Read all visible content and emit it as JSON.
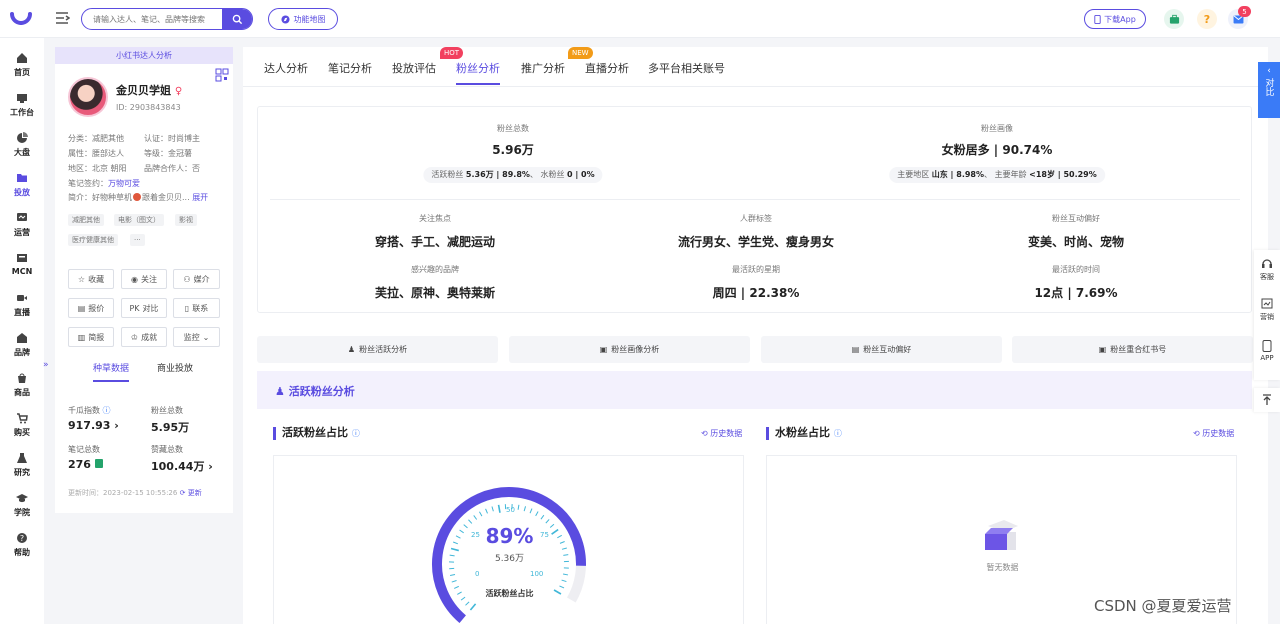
{
  "header": {
    "search_placeholder": "请输入达人、笔记、品牌等搜索",
    "map_label": "功能地图",
    "download_label": "下载App",
    "notification_count": "5",
    "accent": "#5a4ce0"
  },
  "nav": {
    "items": [
      {
        "label": "首页",
        "icon": "home-icon"
      },
      {
        "label": "工作台",
        "icon": "workbench-icon"
      },
      {
        "label": "大盘",
        "icon": "pie-chart-icon"
      },
      {
        "label": "投放",
        "icon": "folder-icon"
      },
      {
        "label": "运营",
        "icon": "operations-icon"
      },
      {
        "label": "MCN",
        "icon": "mcn-icon"
      },
      {
        "label": "直播",
        "icon": "video-icon"
      },
      {
        "label": "品牌",
        "icon": "brand-icon"
      },
      {
        "label": "商品",
        "icon": "goods-icon"
      },
      {
        "label": "购买",
        "icon": "cart-icon"
      },
      {
        "label": "研究",
        "icon": "research-icon"
      },
      {
        "label": "学院",
        "icon": "academy-icon"
      },
      {
        "label": "帮助",
        "icon": "help-icon"
      }
    ],
    "expand_label": "»"
  },
  "profile": {
    "header": "小红书达人分析",
    "name": "金贝贝学姐",
    "gender": "♀",
    "id": "ID: 2903843843",
    "category": "分类：减肥其他",
    "certification": "认证：时尚博主",
    "attribute": "属性：腰部达人",
    "level": "等级：金冠薯",
    "region": "地区：北京 朝阳",
    "brand_partner": "品牌合作人：否",
    "contract_prefix": "笔记签约：",
    "contract_value": "万物可爱",
    "intro_prefix": "简介：好物种草机",
    "intro_text": "跟着金贝贝...",
    "intro_more": "展开",
    "tags": [
      "减肥其他",
      "电影（图文）",
      "影视",
      "医疗健康其他",
      "···"
    ],
    "buttons": {
      "collect": "收藏",
      "follow": "关注",
      "media": "媒介",
      "quote": "报价",
      "compare": "对比",
      "contact": "联系",
      "brief": "简报",
      "deal": "成就",
      "monitor": "监控"
    },
    "tabs": [
      "种草数据",
      "商业投放"
    ],
    "stats": {
      "qiangua_label": "千瓜指数",
      "qiangua_value": "917.93",
      "fans_label": "粉丝总数",
      "fans_value": "5.95万",
      "notes_label": "笔记总数",
      "notes_value": "276",
      "likes_label": "赞藏总数",
      "likes_value": "100.44万"
    },
    "update_time": "更新时间：2023-02-15 10:55:26",
    "update_label": "更新"
  },
  "tabs": {
    "items": [
      "达人分析",
      "笔记分析",
      "投放评估",
      "粉丝分析",
      "推广分析",
      "直播分析",
      "多平台相关账号"
    ],
    "active": "粉丝分析",
    "badge_hot": "HOT",
    "badge_new": "NEW"
  },
  "summary": {
    "fans_total_label": "粉丝总数",
    "fans_total": "5.96万",
    "active_fans_label": "活跃粉丝",
    "active_fans": "5.36万 | 89.8%",
    "water_fans_label": "水粉丝",
    "water_fans": "0 | 0%",
    "portrait_label": "粉丝画像",
    "portrait": "女粉居多 | 90.74%",
    "main_region_label": "主要地区",
    "main_region": "山东 | 8.98%",
    "main_age_label": "主要年龄",
    "main_age": "<18岁 | 50.29%",
    "focus_label": "关注焦点",
    "focus": "穿搭、手工、减肥运动",
    "crowd_label": "人群标签",
    "crowd": "流行男女、学生党、瘦身男女",
    "interact_label": "粉丝互动偏好",
    "interact": "变美、时尚、宠物",
    "brand_label": "感兴趣的品牌",
    "brand": "芙拉、原神、奥特莱斯",
    "active_day_label": "最活跃的星期",
    "active_day": "周四 | 22.38%",
    "active_time_label": "最活跃的时间",
    "active_time": "12点 | 7.69%"
  },
  "section_buttons": [
    "粉丝活跃分析",
    "粉丝画像分析",
    "粉丝互动偏好",
    "粉丝重合红书号"
  ],
  "active_section": {
    "title": "活跃粉丝分析",
    "left_panel_title": "活跃粉丝占比",
    "right_panel_title": "水粉丝占比",
    "history_label": "历史数据",
    "gauge_percent": "89%",
    "gauge_value": 0.89,
    "gauge_count": "5.36万",
    "gauge_caption": "活跃粉丝占比",
    "gauge_ticks": [
      "0",
      "25",
      "50",
      "75",
      "100"
    ],
    "empty_text": "暂无数据"
  },
  "right_rail": {
    "compare_label": "对比",
    "service": "客服",
    "marketing": "营销",
    "app": "APP"
  },
  "watermark": "CSDN @夏夏爱运营"
}
